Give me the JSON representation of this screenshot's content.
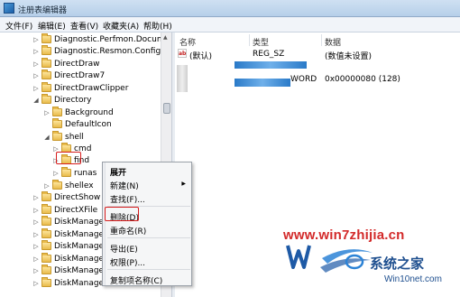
{
  "window": {
    "title": "注册表编辑器"
  },
  "menubar": [
    "文件(F)",
    "编辑(E)",
    "查看(V)",
    "收藏夹(A)",
    "帮助(H)"
  ],
  "tree": [
    {
      "label": "Diagnostic.Perfmon.Document",
      "expand": "▷"
    },
    {
      "label": "Diagnostic.Resmon.Config",
      "expand": "▷"
    },
    {
      "label": "DirectDraw",
      "expand": "▷"
    },
    {
      "label": "DirectDraw7",
      "expand": "▷"
    },
    {
      "label": "DirectDrawClipper",
      "expand": "▷"
    },
    {
      "label": "Directory",
      "expand": "◢"
    },
    {
      "label": "Background",
      "expand": "▷"
    },
    {
      "label": "DefaultIcon",
      "expand": ""
    },
    {
      "label": "shell",
      "expand": "◢"
    },
    {
      "label": "cmd",
      "expand": "▷"
    },
    {
      "label": "find",
      "expand": "▷"
    },
    {
      "label": "runas",
      "expand": "▷"
    },
    {
      "label": "shellex",
      "expand": "▷"
    },
    {
      "label": "DirectShow",
      "expand": "▷"
    },
    {
      "label": "DirectXFile",
      "expand": "▷"
    },
    {
      "label": "DiskManagement",
      "expand": "▷"
    },
    {
      "label": "DiskManagement",
      "expand": "▷"
    },
    {
      "label": "DiskManagement",
      "expand": "▷"
    },
    {
      "label": "DiskManagement",
      "expand": "▷"
    },
    {
      "label": "DiskManagement",
      "expand": "▷"
    },
    {
      "label": "DiskManagement",
      "expand": "▷"
    }
  ],
  "values": {
    "headers": {
      "name": "名称",
      "type": "类型",
      "data": "数据"
    },
    "rows": [
      {
        "name": "(默认)",
        "type": "REG_SZ",
        "data": "(数值未设置)"
      },
      {
        "name": "",
        "type": "WORD",
        "data": "0x00000080 (128)"
      }
    ]
  },
  "context_menu": {
    "expand": "展开",
    "new": "新建(N)",
    "find": "查找(F)...",
    "delete": "删除(D)",
    "rename": "重命名(R)",
    "export": "导出(E)",
    "permissions": "权限(P)...",
    "copy_key_name": "复制项名称(C)"
  },
  "watermark": {
    "url": "www.win7zhijia.cn",
    "brand": "系统之家",
    "site": "Win10net.com"
  }
}
